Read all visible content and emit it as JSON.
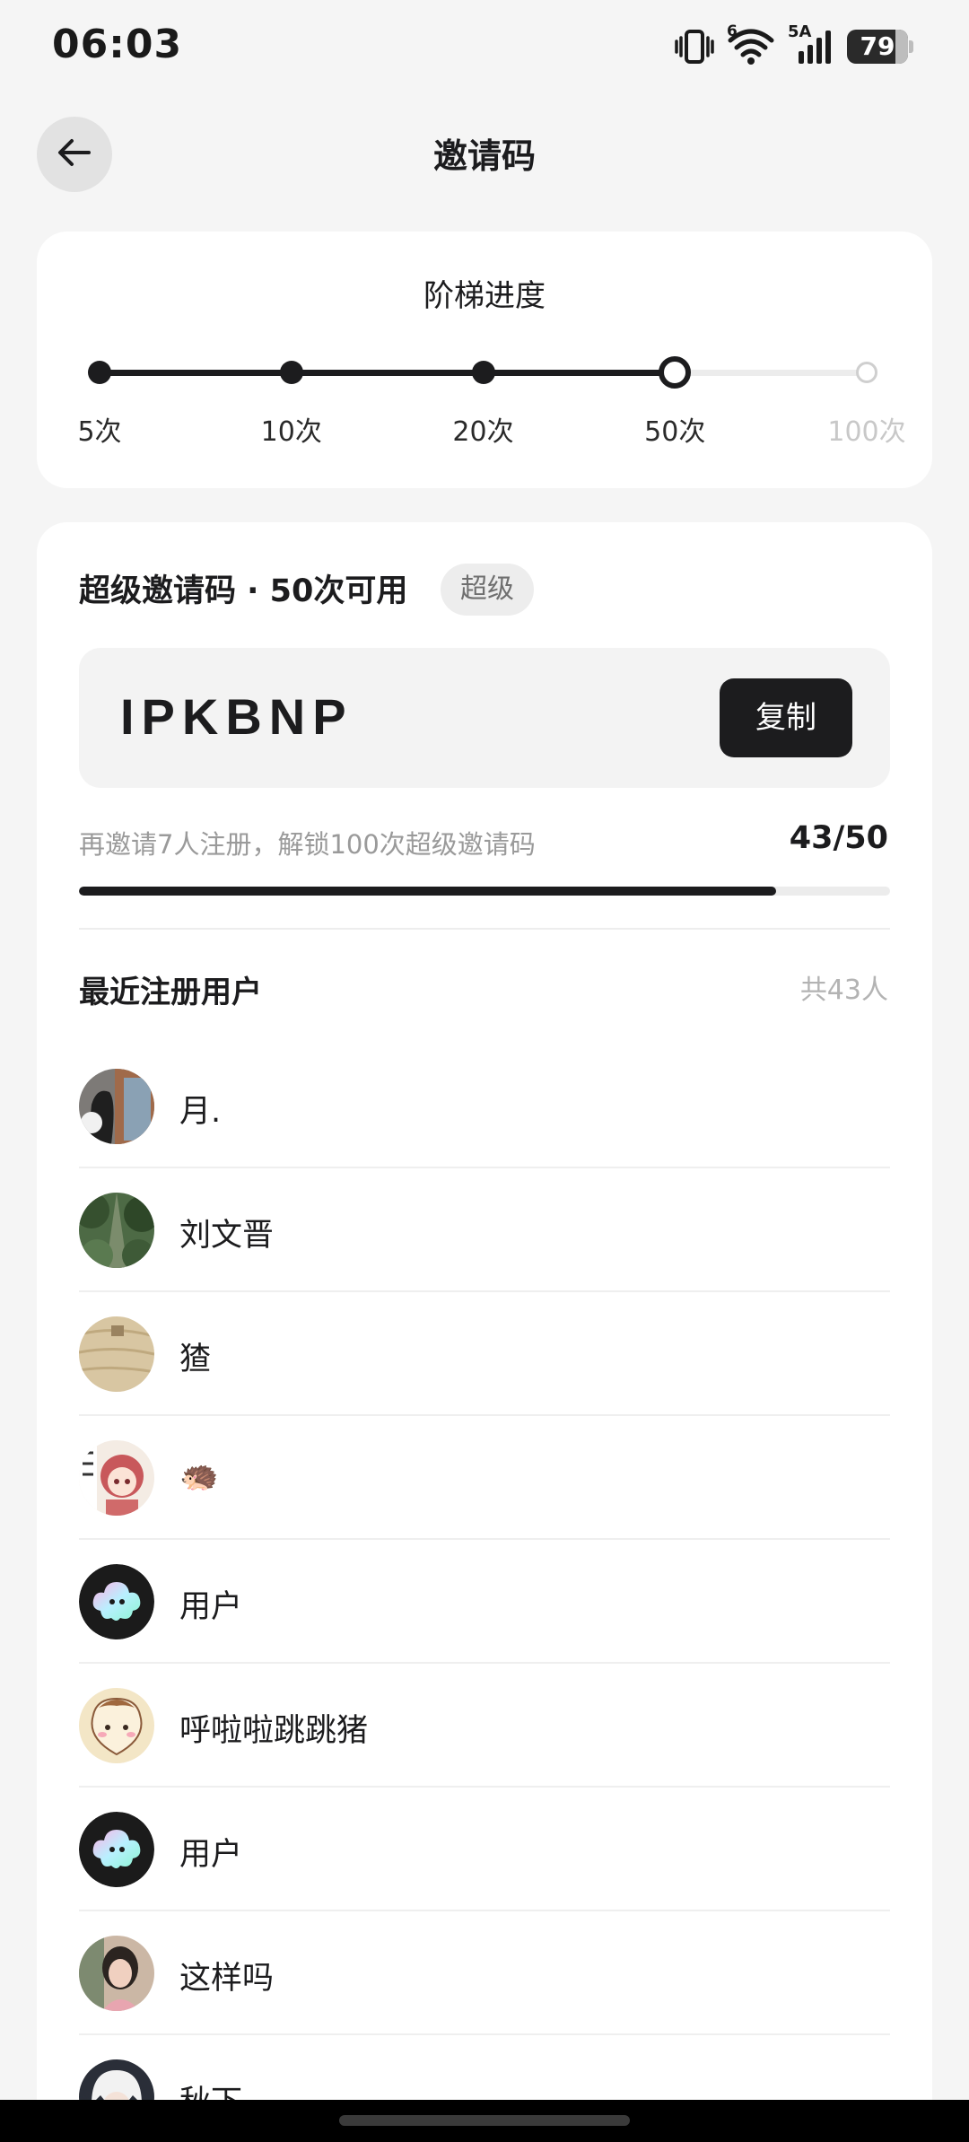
{
  "status_bar": {
    "time": "06:03",
    "network_label": "5A",
    "wifi_label": "6",
    "battery": "79"
  },
  "header": {
    "title": "邀请码"
  },
  "ladder": {
    "title": "阶梯进度",
    "steps": [
      {
        "label": "5次",
        "reached": true
      },
      {
        "label": "10次",
        "reached": true
      },
      {
        "label": "20次",
        "reached": true
      },
      {
        "label": "50次",
        "reached": true,
        "current": true
      },
      {
        "label": "100次",
        "reached": false
      }
    ]
  },
  "invite": {
    "heading": "超级邀请码 · 50次可用",
    "badge": "超级",
    "code": "IPKBNP",
    "copy_label": "复制",
    "hint": "再邀请7人注册，解锁100次超级邀请码",
    "progress_text": "43/50",
    "progress_current": 43,
    "progress_target": 50
  },
  "recent": {
    "title": "最近注册用户",
    "total": "共43人",
    "users": [
      {
        "name": "月.",
        "avatar": "photo-dark-figure"
      },
      {
        "name": "刘文晋",
        "avatar": "photo-trees"
      },
      {
        "name": "猹",
        "avatar": "photo-wood"
      },
      {
        "name": "🦔",
        "avatar": "anime-girl"
      },
      {
        "name": "用户",
        "avatar": "default-cloud"
      },
      {
        "name": "呼啦啦跳跳猪",
        "avatar": "cartoon-pig"
      },
      {
        "name": "用户",
        "avatar": "default-cloud"
      },
      {
        "name": "这样吗",
        "avatar": "photo-portrait"
      },
      {
        "name": "秋下",
        "avatar": "anime-white-hair"
      }
    ]
  }
}
